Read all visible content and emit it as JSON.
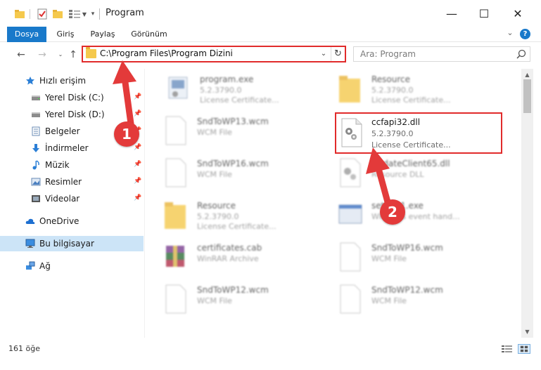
{
  "window": {
    "title": "Program",
    "minimize": "—",
    "maximize": "☐",
    "close": "✕"
  },
  "ribbon": {
    "tabs": [
      {
        "label": "Dosya",
        "active": true
      },
      {
        "label": "Giriş",
        "active": false
      },
      {
        "label": "Paylaş",
        "active": false
      },
      {
        "label": "Görünüm",
        "active": false
      }
    ],
    "help": "?"
  },
  "address": {
    "path": "C:\\Program Files\\Program Dizini"
  },
  "search": {
    "placeholder": "Ara: Program"
  },
  "sidebar": {
    "items": [
      {
        "label": "Hızlı erişim",
        "icon": "star-icon",
        "pinned": false
      },
      {
        "label": "Yerel Disk (C:)",
        "icon": "disk-icon",
        "pinned": true
      },
      {
        "label": "Yerel Disk (D:)",
        "icon": "disk-icon",
        "pinned": true
      },
      {
        "label": "Belgeler",
        "icon": "documents-icon",
        "pinned": true
      },
      {
        "label": "İndirmeler",
        "icon": "download-icon",
        "pinned": true
      },
      {
        "label": "Müzik",
        "icon": "music-icon",
        "pinned": true
      },
      {
        "label": "Resimler",
        "icon": "pictures-icon",
        "pinned": true
      },
      {
        "label": "Videolar",
        "icon": "video-icon",
        "pinned": true
      },
      {
        "label": "OneDrive",
        "icon": "cloud-icon",
        "pinned": false
      },
      {
        "label": "Bu bilgisayar",
        "icon": "computer-icon",
        "pinned": false,
        "selected": true
      },
      {
        "label": "Ağ",
        "icon": "network-icon",
        "pinned": false
      }
    ]
  },
  "files": [
    {
      "name": "program.exe",
      "line2": "5.2.3790.0",
      "line3": "License Certificate..."
    },
    {
      "name": "Resource",
      "line2": "5.2.3790.0",
      "line3": "License Certificate..."
    },
    {
      "name": "SndToWP13.wcm",
      "line2": "WCM File",
      "line3": ""
    },
    {
      "name": "ccfapi32.dll",
      "line2": "5.2.3790.0",
      "line3": "License Certificate..."
    },
    {
      "name": "SndToWP16.wcm",
      "line2": "WCM File",
      "line3": ""
    },
    {
      "name": "UpdateClient65.dll",
      "line2": "Resource DLL",
      "line3": ""
    },
    {
      "name": "Resource",
      "line2": "5.2.3790.0",
      "line3": "License Certificate..."
    },
    {
      "name": "setup51.exe",
      "line2": "Windows event hand...",
      "line3": ""
    },
    {
      "name": "certificates.cab",
      "line2": "WinRAR Archive",
      "line3": ""
    },
    {
      "name": "SndToWP16.wcm",
      "line2": "WCM File",
      "line3": ""
    },
    {
      "name": "SndToWP12.wcm",
      "line2": "WCM File",
      "line3": ""
    },
    {
      "name": "SndToWP12.wcm",
      "line2": "WCM File",
      "line3": ""
    }
  ],
  "status": {
    "count": "161 öğe"
  },
  "annotations": {
    "badge1": "1",
    "badge2": "2",
    "color": "#e33a3a"
  }
}
